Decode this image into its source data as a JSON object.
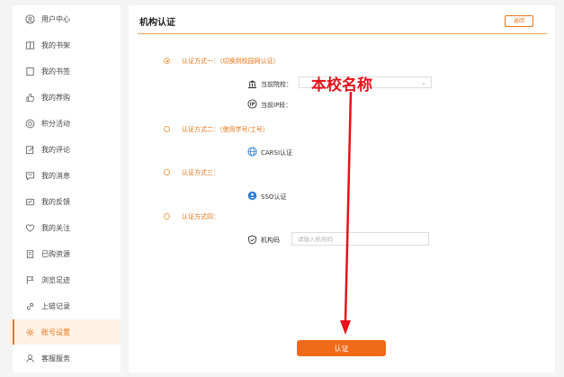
{
  "sidebar": {
    "items": [
      {
        "label": "用户中心",
        "icon": "user-icon"
      },
      {
        "label": "我的书架",
        "icon": "bookshelf-icon"
      },
      {
        "label": "我的书签",
        "icon": "bookmark-icon"
      },
      {
        "label": "我的荐购",
        "icon": "thumbs-up-icon"
      },
      {
        "label": "积分活动",
        "icon": "points-icon"
      },
      {
        "label": "我的评论",
        "icon": "edit-icon"
      },
      {
        "label": "我的消息",
        "icon": "message-icon"
      },
      {
        "label": "我的反馈",
        "icon": "feedback-icon"
      },
      {
        "label": "我的关注",
        "icon": "heart-icon"
      },
      {
        "label": "已购资源",
        "icon": "receipt-icon"
      },
      {
        "label": "浏览足迹",
        "icon": "flag-icon"
      },
      {
        "label": "上链记录",
        "icon": "link-icon"
      },
      {
        "label": "账号设置",
        "icon": "settings-icon"
      },
      {
        "label": "客服服务",
        "icon": "service-icon"
      }
    ],
    "active_index": 12
  },
  "main": {
    "title": "机构认证",
    "back_label": "返回",
    "methods": [
      {
        "label": "认证方式一：（切换到校园网认证）",
        "checked": true
      },
      {
        "label": "认证方式二：（使用学号/工号）",
        "checked": false
      },
      {
        "label": "认证方式三：",
        "checked": false
      },
      {
        "label": "认证方式四：",
        "checked": false
      }
    ],
    "current_school_label": "当前院校：",
    "current_ip_label": "当前IP段：",
    "carsi_label": "CARSI认证",
    "sso_label": "SSO认证",
    "code_label": "机构码",
    "code_placeholder": "请输入机构码",
    "submit_label": "认证"
  },
  "annotation": {
    "text": "本校名称",
    "color": "#e8101a"
  },
  "colors": {
    "accent": "#e8741a",
    "button": "#f06a1a"
  }
}
